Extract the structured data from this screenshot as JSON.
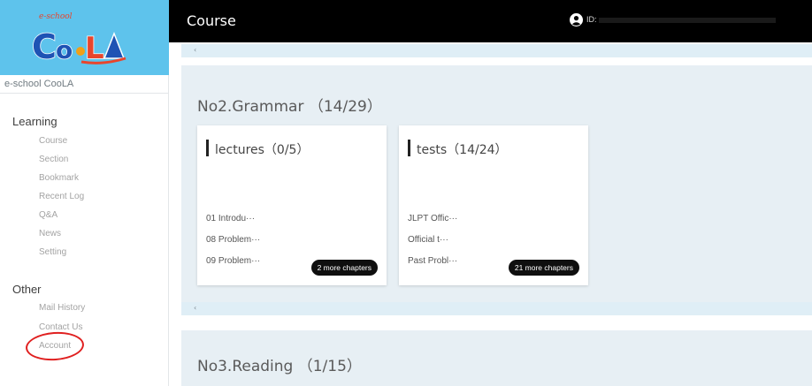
{
  "logo": {
    "small_text": "e-school",
    "main_text": "CooLA"
  },
  "sidebar": {
    "brand": "e-school CooLA",
    "learning_heading": "Learning",
    "learning_items": [
      "Course",
      "Section",
      "Bookmark",
      "Recent Log",
      "Q&A",
      "News",
      "Setting"
    ],
    "other_heading": "Other",
    "other_items": [
      "Mail History",
      "Contact Us",
      "Account"
    ]
  },
  "header": {
    "title": "Course",
    "id_label": "ID:"
  },
  "scroll": {
    "left_arrow": "‹"
  },
  "sections": [
    {
      "title": "No2.Grammar （14/29）",
      "cards": [
        {
          "title": "lectures（0/5）",
          "chapters": [
            "01 Introdu···",
            "08 Problem···",
            "09 Problem···"
          ],
          "more": "2 more chapters"
        },
        {
          "title": "tests（14/24）",
          "chapters": [
            "JLPT Offic···",
            "Official t···",
            "Past Probl···"
          ],
          "more": "21 more chapters"
        }
      ]
    },
    {
      "title": "No3.Reading （1/15）"
    }
  ],
  "colors": {
    "sidebar_header": "#5ec3ec",
    "topbar": "#000000",
    "panel": "#e7eff4",
    "highlight_circle": "#e02020"
  }
}
